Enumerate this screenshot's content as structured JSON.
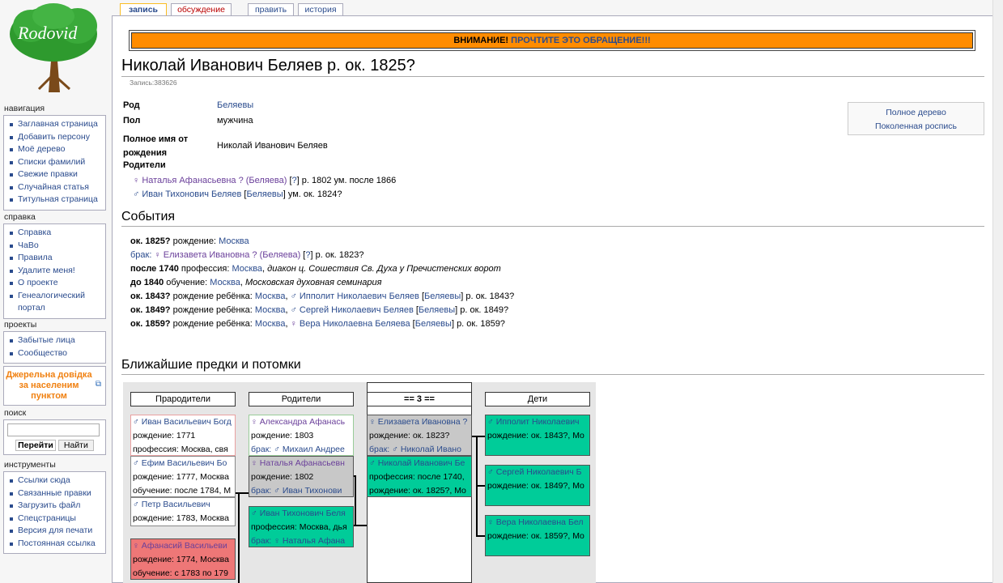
{
  "logo": {
    "text": "Rodovid"
  },
  "tabs": [
    {
      "label": "запись"
    },
    {
      "label": "обсуждение"
    },
    {
      "label": "править"
    },
    {
      "label": "история"
    }
  ],
  "sidebar": {
    "nav": {
      "title": "навигация",
      "items": [
        "Заглавная страница",
        "Добавить персону",
        "Моё дерево",
        "Списки фамилий",
        "Свежие правки",
        "Случайная статья",
        "Титульная страница"
      ]
    },
    "help": {
      "title": "справка",
      "items": [
        "Справка",
        "ЧаВо",
        "Правила",
        "Удалите меня!",
        "О проекте",
        "Генеалогический портал"
      ]
    },
    "projects": {
      "title": "проекты",
      "items": [
        "Забытые лица",
        "Сообщество"
      ]
    },
    "promo": "Джерельна довідка за населеним пунктом",
    "search": {
      "title": "поиск",
      "go": "Перейти",
      "find": "Найти",
      "value": ""
    },
    "tools": {
      "title": "инструменты",
      "items": [
        "Ссылки сюда",
        "Связанные правки",
        "Загрузить файл",
        "Спецстраницы",
        "Версия для печати",
        "Постоянная ссылка"
      ]
    }
  },
  "notice": {
    "prefix": "ВНИМАНИЕ!",
    "link": "ПРОЧТИТЕ ЭТО ОБРАЩЕНИЕ!!!"
  },
  "title": "Николай Иванович Беляев р. ок. 1825?",
  "record": "Запись:383626",
  "info": {
    "rod_label": "Род",
    "rod": "Беляевы",
    "sex_label": "Пол",
    "sex": "мужчина",
    "name_label": "Полное имя от рождения",
    "name": "Николай Иванович Беляев",
    "parents_label": "Родители",
    "mother": {
      "name": "Наталья Афанасьевна ? (Беляева)",
      "q": "?",
      "dates": "р. 1802 ум. после 1866"
    },
    "father": {
      "name": "Иван Тихонович Беляев",
      "rod": "Беляевы",
      "dates": "ум. ок. 1824?"
    }
  },
  "side": {
    "full_tree": "Полное дерево",
    "generations": "Поколенная роспись"
  },
  "events_title": "События",
  "events": [
    {
      "date": "ок. 1825?",
      "type": "рождение:",
      "place": "Москва"
    },
    {
      "label": "брак:",
      "person": "Елизавета Ивановна ? (Беляева)",
      "q": "?",
      "dates": "р. ок. 1823?"
    },
    {
      "date": "после 1740",
      "type": "профессия:",
      "place": "Москва",
      "detail": "диакон ц. Сошествия Св. Духа у Пречистенских ворот"
    },
    {
      "date": "до 1840",
      "type": "обучение:",
      "place": "Москва",
      "detail": "Московская духовная семинария"
    },
    {
      "date": "ок. 1843?",
      "type": "рождение ребёнка:",
      "place": "Москва",
      "person": "Ипполит Николаевич Беляев",
      "rod": "Беляевы",
      "dates": "р. ок. 1843?"
    },
    {
      "date": "ок. 1849?",
      "type": "рождение ребёнка:",
      "place": "Москва",
      "person": "Сергей Николаевич Беляев",
      "rod": "Беляевы",
      "dates": "р. ок. 1849?"
    },
    {
      "date": "ок. 1859?",
      "type": "рождение ребёнка:",
      "place": "Москва",
      "person": "Вера Николаевна Беляева",
      "rod": "Беляевы",
      "dates": "р. ок. 1859?"
    }
  ],
  "tree_title": "Ближайшие предки и потомки",
  "tree": {
    "cols": [
      "Прародители",
      "Родители",
      "== 3 ==",
      "Дети"
    ],
    "grandparents": [
      {
        "name": "♂ Иван Васильевич Богд",
        "l2": "рождение: 1771",
        "l3": "профессия: Москва, свя"
      },
      {
        "name": "♂ Ефим Васильевич Бо",
        "l2": "рождение: 1777, Москва",
        "l3": "обучение: после 1784, М"
      },
      {
        "name": "♂ Петр Васильевич",
        "l2": "рождение: 1783, Москва",
        "l3": ""
      },
      {
        "name": "♀ Афанасий Васильеви",
        "l2": "рождение: 1774, Москва",
        "l3": "обучение: с 1783 по 179"
      }
    ],
    "parents": [
      {
        "name": "♀ Александра Афанась",
        "l2": "рождение: 1803",
        "l3": "брак: ♂ Михаил Андрее"
      },
      {
        "name": "♀ Наталья Афанасьевн",
        "l2": "рождение: 1802",
        "l3": "брак: ♂ Иван Тихонови"
      },
      {
        "name": "♂ Иван Тихонович Беля",
        "l2": "профессия: Москва, дья",
        "l3": "брак: ♀ Наталья Афана"
      }
    ],
    "self": [
      {
        "name": "♀ Елизавета Ивановна ?",
        "l2": "рождение: ок. 1823?",
        "l3": "брак: ♂ Николай Ивано"
      },
      {
        "name": "♂ Николай Иванович Бе",
        "l2": "профессия: после 1740,",
        "l3": "рождение: ок. 1825?, Мо"
      }
    ],
    "children": [
      {
        "name": "♂ Ипполит Николаевич",
        "l2": "рождение: ок. 1843?, Мо"
      },
      {
        "name": "♂ Сергей Николаевич Б",
        "l2": "рождение: ок. 1849?, Мо"
      },
      {
        "name": "♀ Вера Николаевна Бел",
        "l2": "рождение: ок. 1859?, Мо"
      }
    ]
  }
}
